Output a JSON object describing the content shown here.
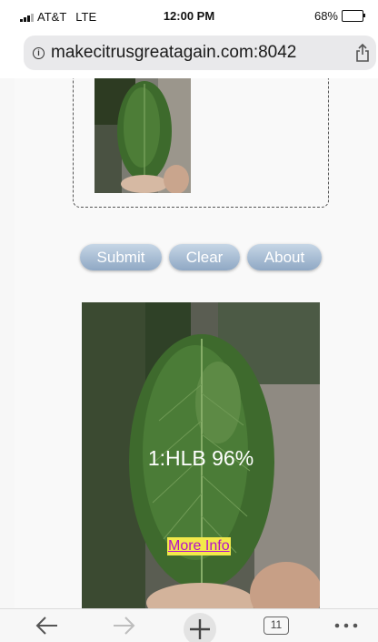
{
  "status_bar": {
    "carrier": "AT&T",
    "network": "LTE",
    "time": "12:00 PM",
    "battery_text": "68%",
    "battery_level": 0.68
  },
  "browser": {
    "url": "makecitrusgreatagain.com:8042",
    "tab_count": "11"
  },
  "buttons": {
    "submit": "Submit",
    "clear": "Clear",
    "about": "About"
  },
  "result": {
    "prediction": "1:HLB 96%",
    "more_info": "More Info"
  },
  "colors": {
    "button_top": "#c6d6e6",
    "button_bottom": "#8fa8c4",
    "more_info_bg": "#f3e94b",
    "more_info_text": "#b512c9"
  }
}
